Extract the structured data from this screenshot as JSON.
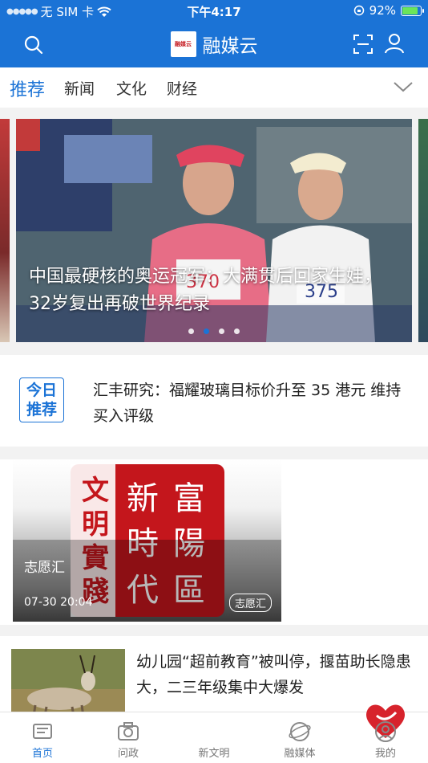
{
  "status_bar": {
    "carrier": "无 SIM 卡",
    "time": "下午4:17",
    "battery": "92%"
  },
  "header": {
    "logo_text": "融媒云",
    "title": "融媒云"
  },
  "tabs": [
    "推荐",
    "新闻",
    "文化",
    "财经"
  ],
  "carousel": {
    "caption": "中国最硬核的奥运冠军：大满贯后回家生娃，32岁复出再破世界纪录",
    "active_index": 1,
    "count": 4
  },
  "today_pick": {
    "badge": "今日推荐",
    "text": "汇丰研究：福耀玻璃目标价升至 35 港元 维持买入评级"
  },
  "video_card": {
    "title": "志愿汇",
    "time": "07-30 20:04",
    "tag": "志愿汇",
    "seal_text": "文明實踐 新富陽 時代區"
  },
  "news_item": {
    "text": "幼儿园“超前教育”被叫停，揠苗助长隐患大，二三年级集中大爆发"
  },
  "bottom_nav": [
    {
      "label": "首页",
      "icon": "home-news-icon"
    },
    {
      "label": "问政",
      "icon": "camera-icon"
    },
    {
      "label": "新文明",
      "icon": "heart-icon"
    },
    {
      "label": "融媒体",
      "icon": "planet-icon"
    },
    {
      "label": "我的",
      "icon": "profile-icon"
    }
  ],
  "colors": {
    "primary": "#1b73d6",
    "seal_red": "#c4161c"
  }
}
